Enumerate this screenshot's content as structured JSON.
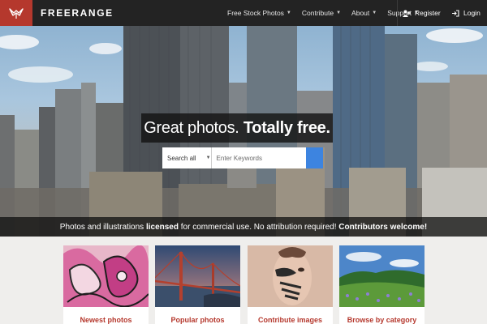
{
  "brand": {
    "name": "FREERANGE",
    "accent": "#b5382d"
  },
  "nav": {
    "items": [
      {
        "label": "Free Stock Photos"
      },
      {
        "label": "Contribute"
      },
      {
        "label": "About"
      },
      {
        "label": "Support"
      }
    ],
    "register": "Register",
    "login": "Login"
  },
  "hero": {
    "tagline_regular": "Great photos.",
    "tagline_bold": "Totally free.",
    "search": {
      "scope": "Search all",
      "placeholder": "Enter Keywords",
      "button_color": "#3d84e0"
    },
    "strip": {
      "part1": "Photos and illustrations ",
      "part2": "licensed",
      "part3": " for commercial use. No attribution required! ",
      "part4": "Contributors welcome!"
    }
  },
  "cards": [
    {
      "label": "Newest photos",
      "icon": "graffiti-image"
    },
    {
      "label": "Popular photos",
      "icon": "bridge-image"
    },
    {
      "label": "Contribute images",
      "icon": "face-paint-image"
    },
    {
      "label": "Browse by category",
      "icon": "field-image"
    }
  ]
}
